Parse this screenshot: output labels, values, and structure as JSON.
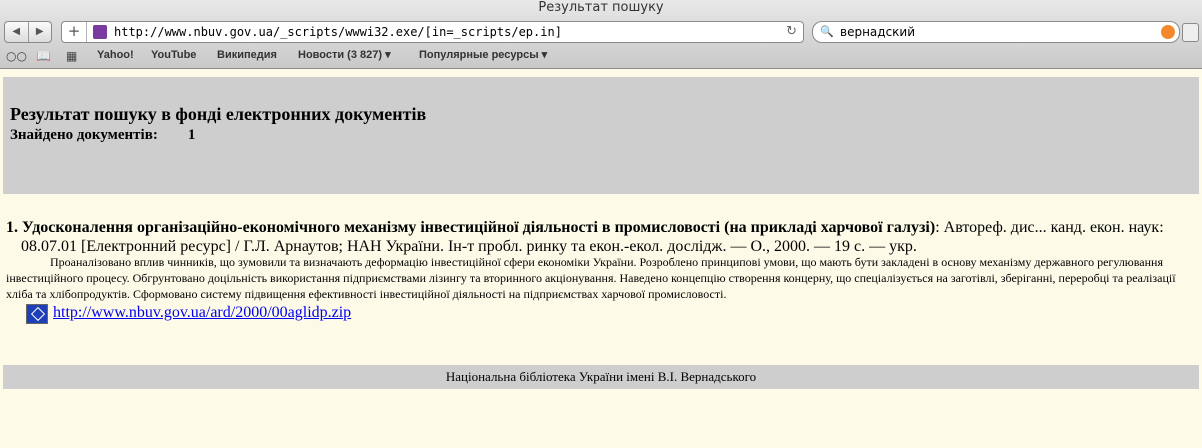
{
  "browser": {
    "window_title": "Результат пошуку",
    "url": "http://www.nbuv.gov.ua/_scripts/wwwi32.exe/[in=_scripts/ep.in]",
    "search_value": "вернадский",
    "bookmarks": [
      "Yahoo!",
      "YouTube",
      "Википедия",
      "Новости (3 827) ▾",
      "Популярные ресурсы ▾"
    ]
  },
  "header": {
    "title": "Результат пошуку в фонді електронних документів",
    "found_label": "Знайдено документів:",
    "found_count": "1"
  },
  "result": {
    "number": "1.",
    "title": "Удосконалення організаційно-економічного механізму інвестиційної діяльності в промисловості (на прикладі харчової галузі)",
    "desc_part1": ": Автореф. дис... канд. екон. наук:",
    "desc_part2": "08.07.01 [Електронний ресурс] / Г.Л. Арнаутов; НАН України. Ін-т пробл. ринку та екон.-екол. дослідж. — О., 2000. — 19 с. — укр.",
    "abstract": "Проаналізовано вплив чинників, що зумовили та визначають деформацію інвестиційної сфери економіки України. Розроблено принципові умови, що мають бути закладені в основу механізму державного регулювання інвестиційного процесу. Обгрунтовано доцільність використання підприємствами лізингу та вторинного акціонування. Наведено концепцію створення концерну, що спеціалізується на заготівлі, зберіганні, переробці та реалізації хліба та хлібопродуктів. Сформовано систему підвищення ефективності інвестиційної діяльності на підприємствах харчової промисловості.",
    "link": "http://www.nbuv.gov.ua/ard/2000/00aglidp.zip"
  },
  "footer": {
    "text": "Національна бібліотека України імені В.І. Вернадського"
  }
}
